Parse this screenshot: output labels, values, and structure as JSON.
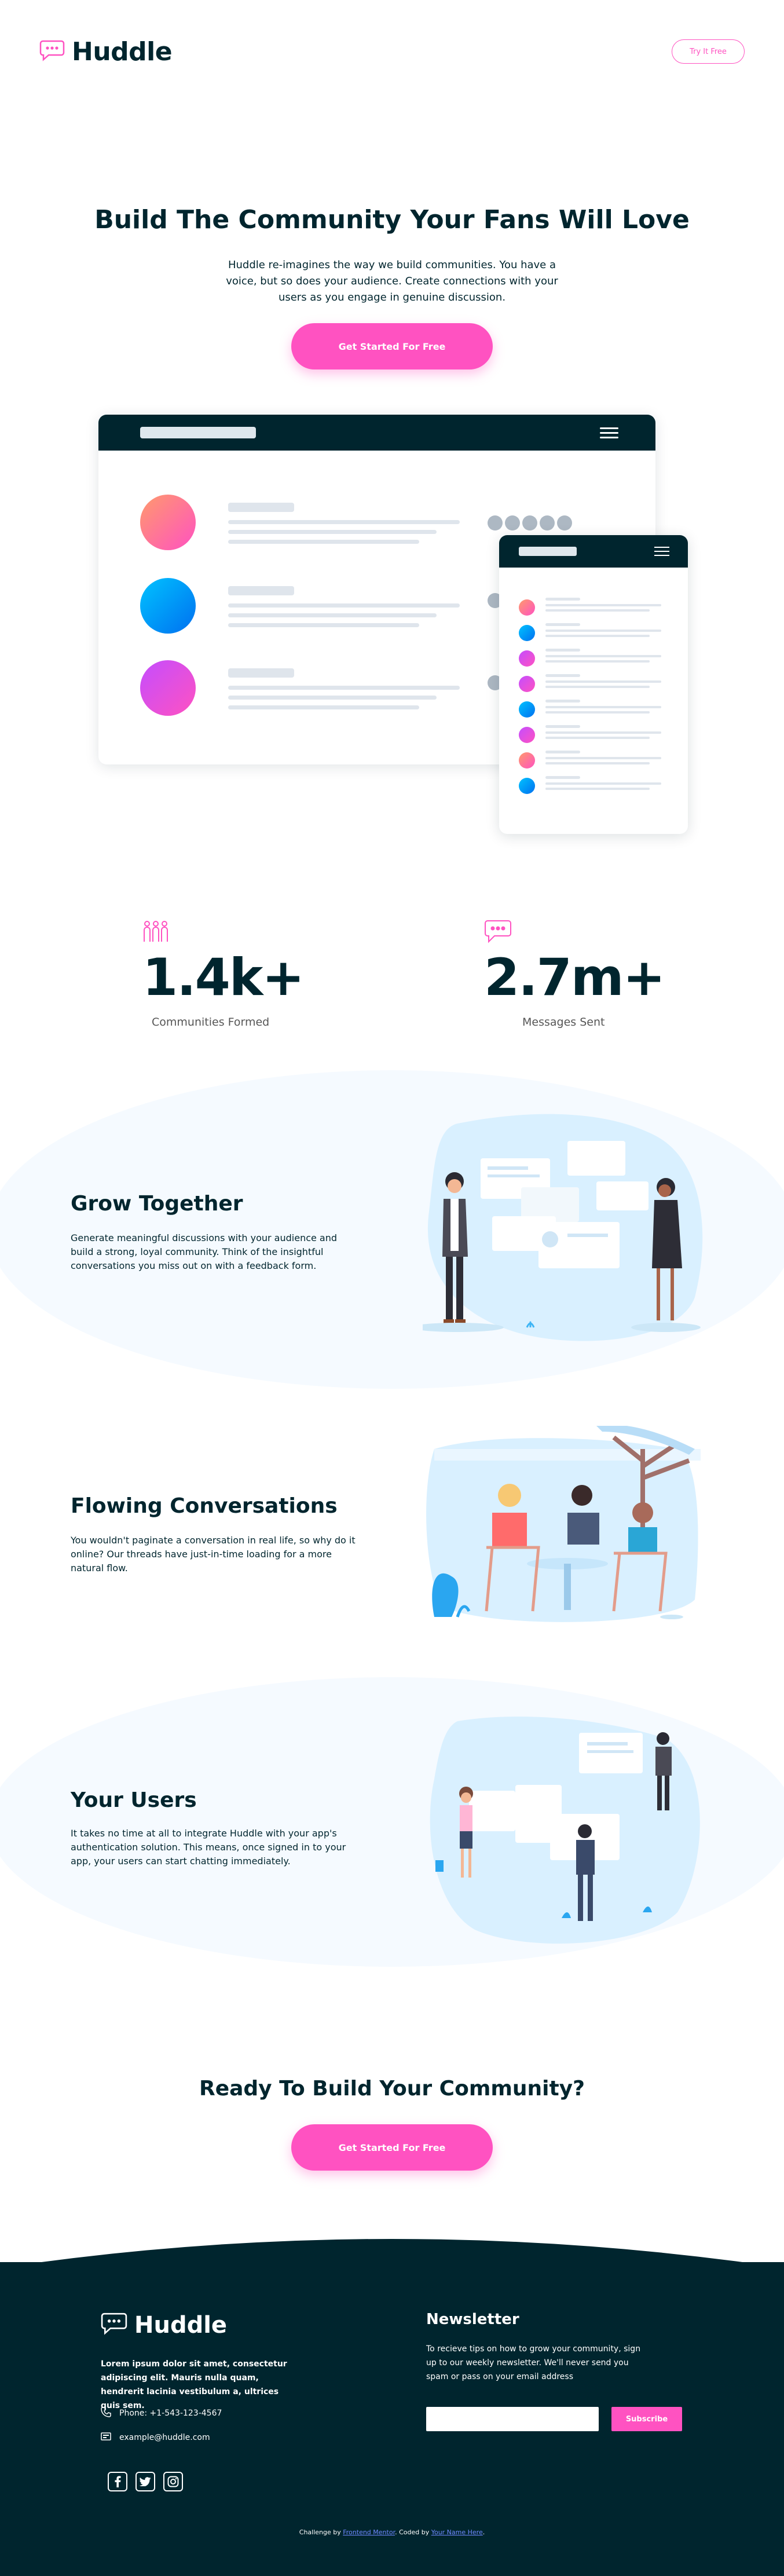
{
  "header": {
    "logo_text": "Huddle",
    "logo_icon": "chat-bubble-icon",
    "try_button": "Try It Free"
  },
  "hero": {
    "title": "Build The Community Your Fans Will Love",
    "description": "Huddle re-imagines the way we build communities. You have a voice, but so does your audience. Create connections with your users as you engage in genuine discussion.",
    "cta": "Get Started For Free"
  },
  "stats": [
    {
      "icon": "communities-icon",
      "value": "1.4k+",
      "label": "Communities Formed"
    },
    {
      "icon": "messages-icon",
      "value": "2.7m+",
      "label": "Messages Sent"
    }
  ],
  "features": [
    {
      "title": "Grow Together",
      "description": "Generate meaningful discussions with your audience and build a strong, loyal community. Think of the insightful conversations you miss out on with a feedback form."
    },
    {
      "title": "Flowing Conversations",
      "description": "You wouldn't paginate a conversation in real life, so why do it online? Our threads have just-in-time loading for a more natural flow."
    },
    {
      "title": "Your Users",
      "description": "It takes no time at all to integrate Huddle with your app's authentication solution. This means, once signed in to your app, your users can start chatting immediately."
    }
  ],
  "cta_section": {
    "title": "Ready To Build Your Community?",
    "button": "Get Started For Free"
  },
  "footer": {
    "logo_text": "Huddle",
    "about": "Lorem ipsum dolor sit amet, consectetur adipiscing elit. Mauris nulla quam, hendrerit lacinia vestibulum a, ultrices quis sem.",
    "phone": "Phone: +1-543-123-4567",
    "email": "example@huddle.com",
    "social": [
      "facebook-icon",
      "twitter-icon",
      "instagram-icon"
    ],
    "newsletter": {
      "title": "Newsletter",
      "description": "To recieve tips on how to grow your community, sign up to our weekly newsletter. We'll never send you spam or pass on your email address",
      "input_value": "",
      "button": "Subscribe"
    },
    "attribution": {
      "prefix": "Challenge by",
      "link1": "Frontend Mentor",
      "middle": ". Coded by",
      "link2": "Your Name Here",
      "suffix": "."
    }
  },
  "colors": {
    "dark": "#00252e",
    "pink": "#ff52c1",
    "light_bg": "#f5faff"
  }
}
